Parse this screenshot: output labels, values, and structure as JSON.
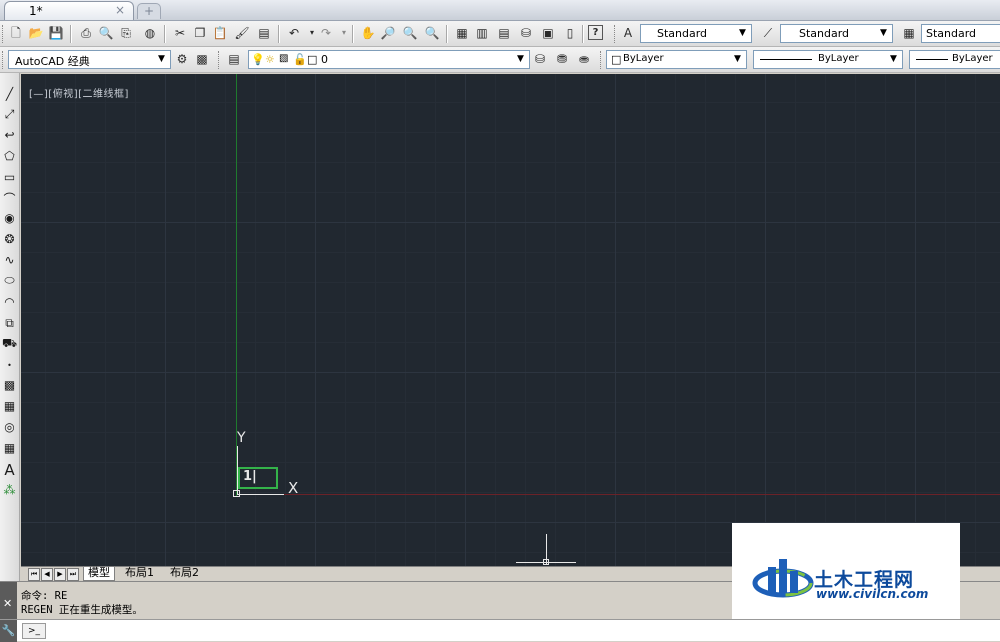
{
  "tabs": {
    "doc_title": "1*",
    "close_glyph": "×",
    "new_glyph": "+"
  },
  "toolbar1": {
    "text_style": "Standard",
    "dim_style": "Standard",
    "table_style": "Standard",
    "help_glyph": "?"
  },
  "toolbar2": {
    "workspace": "AutoCAD 经典",
    "layer": "0",
    "color": "ByLayer",
    "linetype": "ByLayer",
    "lineweight": "ByLayer"
  },
  "canvas": {
    "viewport_label": "[—][俯视][二维线框]",
    "y_axis_label": "Y",
    "x_axis_label": "X",
    "ucs_icon_text": "1|",
    "colors": {
      "background": "#212830",
      "y_axis": "#1f7a2e",
      "x_axis": "#6b2228"
    }
  },
  "layout_tabs": {
    "model": "模型",
    "layout1": "布局1",
    "layout2": "布局2"
  },
  "command": {
    "line1": "命令: RE",
    "line2": "REGEN 正在重生成模型。",
    "input_value": "",
    "prompt_btn": ">_"
  },
  "watermark": {
    "cn_text": "土木工程网",
    "url": "www.civilcn.com"
  }
}
